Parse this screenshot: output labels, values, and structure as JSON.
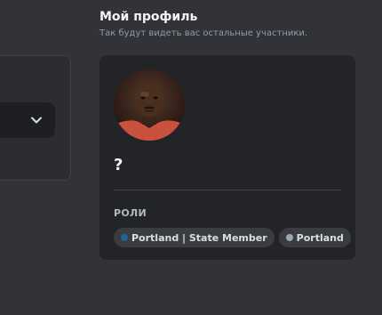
{
  "profile_section": {
    "title": "Мой профиль",
    "subtitle": "Так будут видеть вас остальные участники."
  },
  "left_panel": {
    "select_icon": "chevron-down-icon"
  },
  "profile_card": {
    "display_name": "?",
    "roles_heading": "РОЛИ",
    "roles": [
      {
        "label": "Portland | State Member",
        "color": "#206694"
      },
      {
        "label": "Portland",
        "color": "#99aab5"
      }
    ]
  },
  "colors": {
    "background": "#313338",
    "card": "#232428",
    "role_pill": "#3a3c42"
  }
}
